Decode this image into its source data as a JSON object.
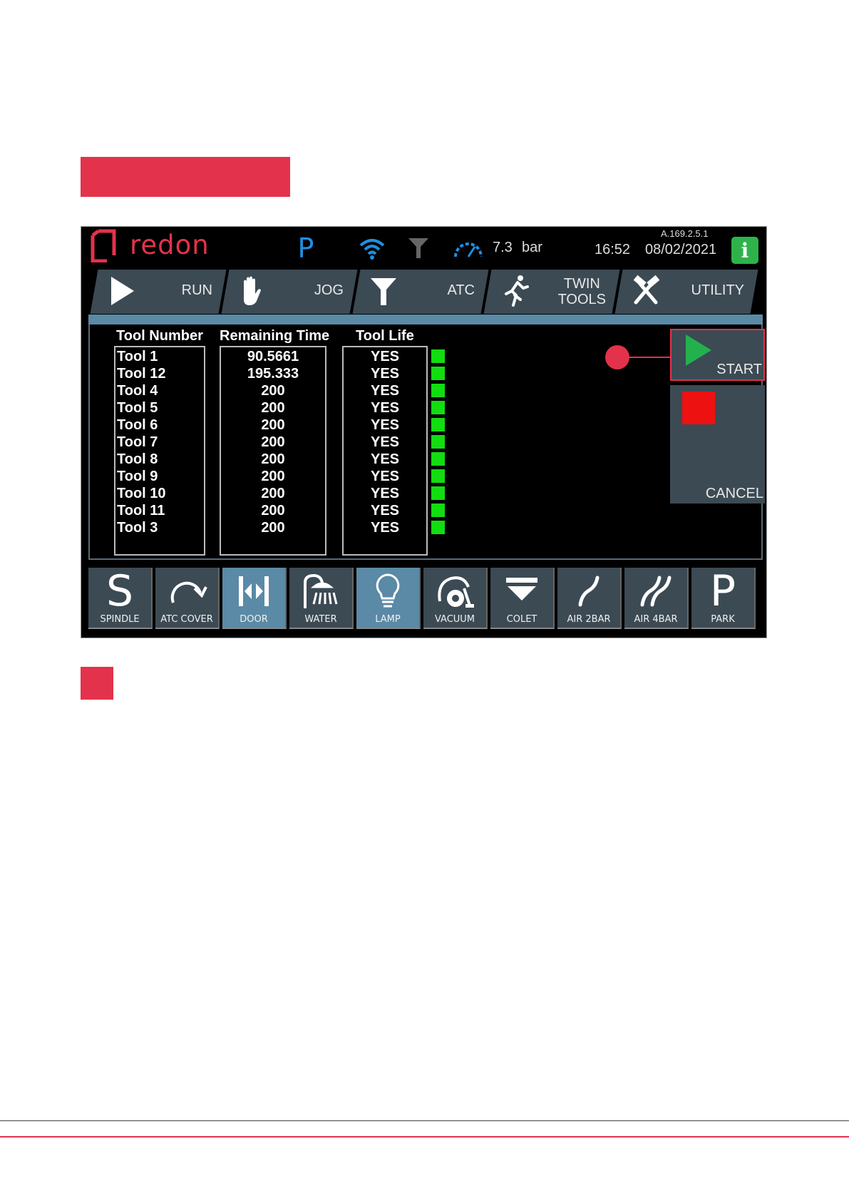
{
  "header": {
    "brand": "redon",
    "p_mode": "P",
    "pressure_value": "7.3",
    "pressure_unit": "bar",
    "time": "16:52",
    "date": "08/02/2021",
    "version": "A.169.2.5.1",
    "info_icon": "i"
  },
  "tabs": [
    {
      "label": "RUN",
      "icon": "play-icon"
    },
    {
      "label": "JOG",
      "icon": "hand-icon"
    },
    {
      "label": "ATC",
      "icon": "funnel-icon"
    },
    {
      "label": "TWIN\nTOOLS",
      "icon": "running-man-icon"
    },
    {
      "label": "UTILITY",
      "icon": "hammer-wrench-icon"
    }
  ],
  "table": {
    "headers": [
      "Tool Number",
      "Remaining Time",
      "Tool Life"
    ],
    "rows": [
      {
        "tool": "Tool 1",
        "remaining": "90.5661",
        "life": "YES"
      },
      {
        "tool": "Tool 12",
        "remaining": "195.333",
        "life": "YES"
      },
      {
        "tool": "Tool 4",
        "remaining": "200",
        "life": "YES"
      },
      {
        "tool": "Tool 5",
        "remaining": "200",
        "life": "YES"
      },
      {
        "tool": "Tool 6",
        "remaining": "200",
        "life": "YES"
      },
      {
        "tool": "Tool 7",
        "remaining": "200",
        "life": "YES"
      },
      {
        "tool": "Tool 8",
        "remaining": "200",
        "life": "YES"
      },
      {
        "tool": "Tool 9",
        "remaining": "200",
        "life": "YES"
      },
      {
        "tool": "Tool 10",
        "remaining": "200",
        "life": "YES"
      },
      {
        "tool": "Tool 11",
        "remaining": "200",
        "life": "YES"
      },
      {
        "tool": "Tool 3",
        "remaining": "200",
        "life": "YES"
      }
    ],
    "status_color": "#11dd11"
  },
  "controls": {
    "start_label": "START",
    "cancel_label": "CANCEL"
  },
  "functions": [
    {
      "label": "SPINDLE",
      "glyph": "S",
      "active": false
    },
    {
      "label": "ATC COVER",
      "icon": "rotate-arrow-icon",
      "active": false
    },
    {
      "label": "DOOR",
      "icon": "door-icon",
      "active": true
    },
    {
      "label": "WATER",
      "icon": "shower-icon",
      "active": false
    },
    {
      "label": "LAMP",
      "icon": "lightbulb-icon",
      "active": true
    },
    {
      "label": "VACUUM",
      "icon": "vacuum-icon",
      "active": false
    },
    {
      "label": "COLET",
      "icon": "colet-icon",
      "active": false
    },
    {
      "label": "AIR 2BAR",
      "icon": "air-icon",
      "active": false
    },
    {
      "label": "AIR 4BAR",
      "icon": "air-double-icon",
      "active": false
    },
    {
      "label": "PARK",
      "glyph": "P",
      "active": false
    }
  ],
  "colors": {
    "accent": "#e3324c",
    "panel": "#3c4a54",
    "active": "#5a8aa6",
    "start_green": "#23b14d",
    "stop_red": "#ee1111"
  }
}
